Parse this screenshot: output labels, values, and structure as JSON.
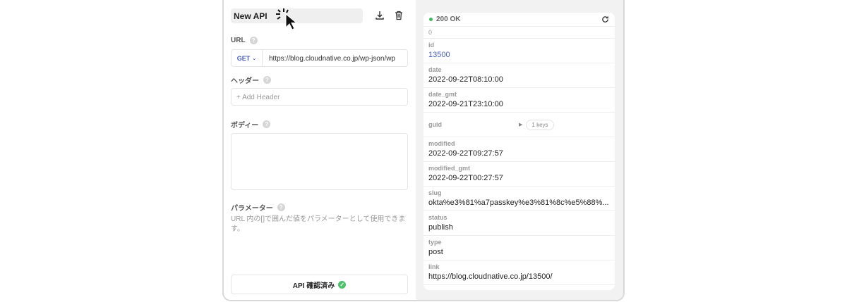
{
  "request": {
    "title": "New API",
    "url_label": "URL",
    "method": "GET",
    "url": "https://blog.cloudnative.co.jp/wp-json/wp",
    "headers_label": "ヘッダー",
    "add_header": "+ Add Header",
    "body_label": "ボディー",
    "body_value": "",
    "params_label": "パラメーター",
    "params_hint": "URL 内の[]で囲んだ値をパラメーターとして使用できます。",
    "verified_button": "API 確認済み",
    "help": "?"
  },
  "response": {
    "status": "200 OK",
    "status_color": "#3dbb5a",
    "index": "0",
    "fields": [
      {
        "key": "id",
        "value": "13500"
      },
      {
        "key": "date",
        "value": "2022-09-22T08:10:00"
      },
      {
        "key": "date_gmt",
        "value": "2022-09-21T23:10:00"
      },
      {
        "key": "guid",
        "value": "1 keys"
      },
      {
        "key": "modified",
        "value": "2022-09-22T09:27:57"
      },
      {
        "key": "modified_gmt",
        "value": "2022-09-22T00:27:57"
      },
      {
        "key": "slug",
        "value": "okta%e3%81%a7passkey%e3%81%8c%e5%88%..."
      },
      {
        "key": "status",
        "value": "publish"
      },
      {
        "key": "type",
        "value": "post"
      },
      {
        "key": "link",
        "value": "https://blog.cloudnative.co.jp/13500/"
      }
    ]
  }
}
